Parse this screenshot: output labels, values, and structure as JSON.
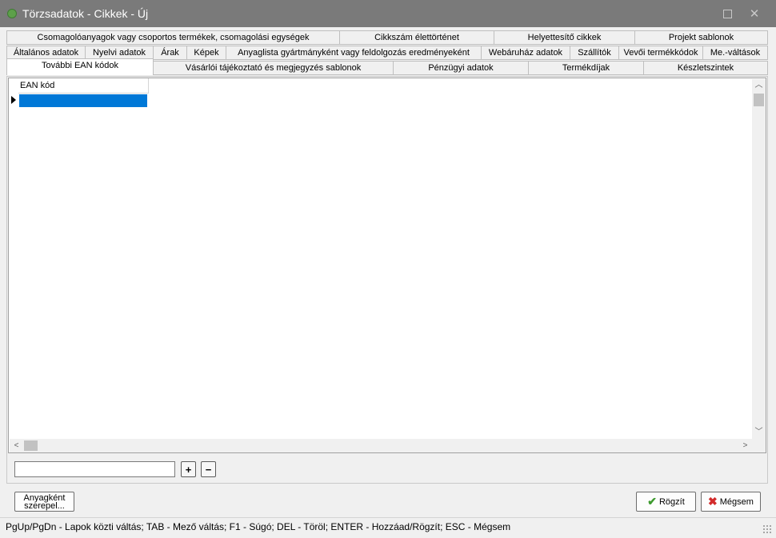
{
  "window": {
    "title": "Törzsadatok - Cikkek - Új",
    "close_glyph": "✕"
  },
  "tabs": {
    "row1": [
      "Csomagolóanyagok vagy csoportos termékek, csomagolási egységek",
      "Cikkszám élettörténet",
      "Helyettesítő cikkek",
      "Projekt sablonok"
    ],
    "row2": [
      "Általános adatok",
      "Nyelvi adatok",
      "Árak",
      "Képek",
      "Anyaglista gyártmányként vagy feldolgozás eredményeként",
      "Webáruház adatok",
      "Szállítók",
      "Vevői termékkódok",
      "Me.-váltások"
    ],
    "row3": [
      "További EAN kódok",
      "Vásárlói tájékoztató és megjegyzés sablonok",
      "Pénzügyi adatok",
      "Termékdíjak",
      "Készletszintek"
    ],
    "active": "További EAN kódok"
  },
  "grid": {
    "columns": [
      "EAN kód"
    ],
    "rows": [
      [
        ""
      ]
    ]
  },
  "editor": {
    "input_value": "",
    "add_glyph": "+",
    "remove_glyph": "−"
  },
  "buttons": {
    "as_material_line1": "Anyagként",
    "as_material_line2": "szerepel...",
    "save": "Rögzít",
    "cancel": "Mégsem"
  },
  "status": {
    "text": "PgUp/PgDn - Lapok közti váltás; TAB - Mező váltás; F1 - Súgó; DEL - Töröl; ENTER - Hozzáad/Rögzít; ESC - Mégsem"
  },
  "icons": {
    "app": "app-icon",
    "maximize": "maximize-icon",
    "close": "close-icon",
    "row_indicator": "row-pointer-icon",
    "save": "check-icon",
    "cancel": "x-icon"
  },
  "colors": {
    "titlebar": "#7a7a7a",
    "selection": "#0078d7",
    "save_icon": "#3d9a2e",
    "cancel_icon": "#d22a2a"
  }
}
